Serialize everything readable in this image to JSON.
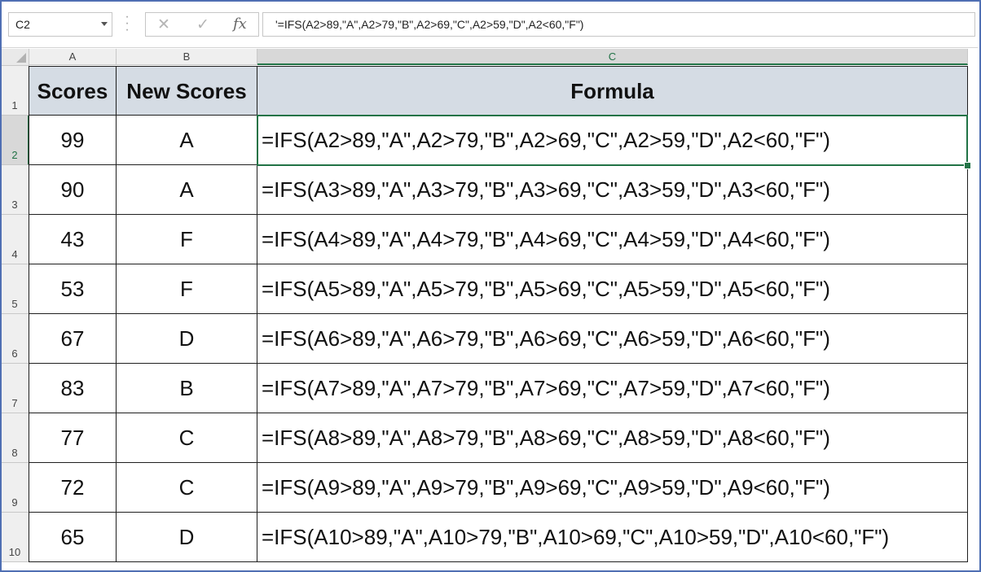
{
  "name_box": {
    "value": "C2"
  },
  "formula_bar": {
    "cancel_glyph": "✕",
    "enter_glyph": "✓",
    "fx_label": "fx",
    "content": "'=IFS(A2>89,\"A\",A2>79,\"B\",A2>69,\"C\",A2>59,\"D\",A2<60,\"F\")"
  },
  "columns": [
    "A",
    "B",
    "C"
  ],
  "header_row": {
    "row_number": "1",
    "cells": [
      "Scores",
      "New Scores",
      "Formula"
    ]
  },
  "rows": [
    {
      "row_number": "2",
      "score": "99",
      "new_score": "A",
      "formula": "=IFS(A2>89,\"A\",A2>79,\"B\",A2>69,\"C\",A2>59,\"D\",A2<60,\"F\")"
    },
    {
      "row_number": "3",
      "score": "90",
      "new_score": "A",
      "formula": "=IFS(A3>89,\"A\",A3>79,\"B\",A3>69,\"C\",A3>59,\"D\",A3<60,\"F\")"
    },
    {
      "row_number": "4",
      "score": "43",
      "new_score": "F",
      "formula": "=IFS(A4>89,\"A\",A4>79,\"B\",A4>69,\"C\",A4>59,\"D\",A4<60,\"F\")"
    },
    {
      "row_number": "5",
      "score": "53",
      "new_score": "F",
      "formula": "=IFS(A5>89,\"A\",A5>79,\"B\",A5>69,\"C\",A5>59,\"D\",A5<60,\"F\")"
    },
    {
      "row_number": "6",
      "score": "67",
      "new_score": "D",
      "formula": "=IFS(A6>89,\"A\",A6>79,\"B\",A6>69,\"C\",A6>59,\"D\",A6<60,\"F\")"
    },
    {
      "row_number": "7",
      "score": "83",
      "new_score": "B",
      "formula": "=IFS(A7>89,\"A\",A7>79,\"B\",A7>69,\"C\",A7>59,\"D\",A7<60,\"F\")"
    },
    {
      "row_number": "8",
      "score": "77",
      "new_score": "C",
      "formula": "=IFS(A8>89,\"A\",A8>79,\"B\",A8>69,\"C\",A8>59,\"D\",A8<60,\"F\")"
    },
    {
      "row_number": "9",
      "score": "72",
      "new_score": "C",
      "formula": "=IFS(A9>89,\"A\",A9>79,\"B\",A9>69,\"C\",A9>59,\"D\",A9<60,\"F\")"
    },
    {
      "row_number": "10",
      "score": "65",
      "new_score": "D",
      "formula": "=IFS(A10>89,\"A\",A10>79,\"B\",A10>69,\"C\",A10>59,\"D\",A10<60,\"F\")"
    }
  ],
  "selected_cell": "C2",
  "colors": {
    "accent": "#217346",
    "header_fill": "#d5dce4",
    "frame": "#4f6fb3"
  }
}
